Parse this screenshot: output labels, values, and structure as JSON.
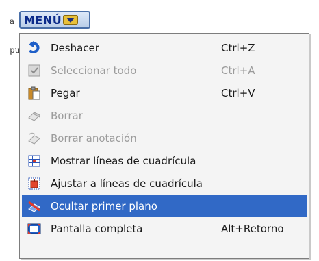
{
  "background": {
    "chars": [
      "a",
      "pu"
    ]
  },
  "menu_button": {
    "label": "MENÚ",
    "icon": "triangle-down-icon"
  },
  "menu": {
    "items": [
      {
        "label": "Deshacer",
        "shortcut": "Ctrl+Z",
        "icon": "undo-icon",
        "disabled": false,
        "selected": false
      },
      {
        "label": "Seleccionar todo",
        "shortcut": "Ctrl+A",
        "icon": "select-all-icon",
        "disabled": true,
        "selected": false
      },
      {
        "label": "Pegar",
        "shortcut": "Ctrl+V",
        "icon": "paste-icon",
        "disabled": false,
        "selected": false
      },
      {
        "label": "Borrar",
        "shortcut": "",
        "icon": "eraser-icon",
        "disabled": true,
        "selected": false
      },
      {
        "label": "Borrar anotación",
        "shortcut": "",
        "icon": "erase-annotation-icon",
        "disabled": true,
        "selected": false
      },
      {
        "label": "Mostrar líneas de cuadrícula",
        "shortcut": "",
        "icon": "show-grid-icon",
        "disabled": false,
        "selected": false
      },
      {
        "label": "Ajustar a líneas de cuadrícula",
        "shortcut": "",
        "icon": "snap-grid-icon",
        "disabled": false,
        "selected": false
      },
      {
        "label": "Ocultar primer plano",
        "shortcut": "",
        "icon": "hide-foreground-icon",
        "disabled": false,
        "selected": true
      },
      {
        "label": "Pantalla completa",
        "shortcut": "Alt+Retorno",
        "icon": "fullscreen-icon",
        "disabled": false,
        "selected": false
      }
    ]
  },
  "colors": {
    "highlight": "#3169c6",
    "menu_bg": "#f4f4f4",
    "disabled_text": "#9b9b9b",
    "button_text": "#0b2a8a"
  }
}
